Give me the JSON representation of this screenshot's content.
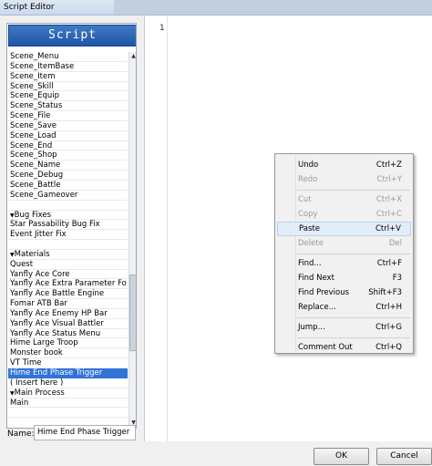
{
  "window": {
    "title": "Script Editor"
  },
  "script_list": {
    "header": "Script",
    "items": [
      {
        "label": "Scene_Menu"
      },
      {
        "label": "Scene_ItemBase"
      },
      {
        "label": "Scene_Item"
      },
      {
        "label": "Scene_Skill"
      },
      {
        "label": "Scene_Equip"
      },
      {
        "label": "Scene_Status"
      },
      {
        "label": "Scene_File"
      },
      {
        "label": "Scene_Save"
      },
      {
        "label": "Scene_Load"
      },
      {
        "label": "Scene_End"
      },
      {
        "label": "Scene_Shop"
      },
      {
        "label": "Scene_Name"
      },
      {
        "label": "Scene_Debug"
      },
      {
        "label": "Scene_Battle"
      },
      {
        "label": "Scene_Gameover"
      },
      {
        "label": ""
      },
      {
        "label": "Bug Fixes",
        "section": true
      },
      {
        "label": "Star Passability Bug Fix"
      },
      {
        "label": "Event Jitter Fix"
      },
      {
        "label": ""
      },
      {
        "label": "Materials",
        "section": true
      },
      {
        "label": "Quest"
      },
      {
        "label": "Yanfly Ace Core"
      },
      {
        "label": "Yanfly Ace Extra Parameter Fo"
      },
      {
        "label": "Yanfly Ace Battle Engine"
      },
      {
        "label": "Fomar ATB Bar"
      },
      {
        "label": "Yanfly Ace Enemy HP Bar"
      },
      {
        "label": "Yanfly Ace Visual Battler"
      },
      {
        "label": "Yanfly Ace Status Menu"
      },
      {
        "label": "Hime Large Troop"
      },
      {
        "label": "Monster book"
      },
      {
        "label": "VT Time"
      },
      {
        "label": "Hime End Phase Trigger",
        "selected": true
      },
      {
        "label": "( Insert here )"
      },
      {
        "label": "Main Process",
        "section": true
      },
      {
        "label": "Main"
      },
      {
        "label": ""
      }
    ],
    "scroll_position": 0.76
  },
  "name_field": {
    "label": "Name:",
    "value": "Hime End Phase Trigger"
  },
  "editor": {
    "line_number": "1",
    "content": ""
  },
  "buttons": {
    "ok": "OK",
    "cancel": "Cancel"
  },
  "context_menu": {
    "groups": [
      [
        {
          "label": "Undo",
          "shortcut": "Ctrl+Z",
          "enabled": true
        },
        {
          "label": "Redo",
          "shortcut": "Ctrl+Y",
          "enabled": false
        }
      ],
      [
        {
          "label": "Cut",
          "shortcut": "Ctrl+X",
          "enabled": false
        },
        {
          "label": "Copy",
          "shortcut": "Ctrl+C",
          "enabled": false
        },
        {
          "label": "Paste",
          "shortcut": "Ctrl+V",
          "enabled": true,
          "highlighted": true
        },
        {
          "label": "Delete",
          "shortcut": "Del",
          "enabled": false
        }
      ],
      [
        {
          "label": "Find...",
          "shortcut": "Ctrl+F",
          "enabled": true
        },
        {
          "label": "Find Next",
          "shortcut": "F3",
          "enabled": true
        },
        {
          "label": "Find Previous",
          "shortcut": "Shift+F3",
          "enabled": true
        },
        {
          "label": "Replace...",
          "shortcut": "Ctrl+H",
          "enabled": true
        }
      ],
      [
        {
          "label": "Jump...",
          "shortcut": "Ctrl+G",
          "enabled": true
        }
      ],
      [
        {
          "label": "Comment Out",
          "shortcut": "Ctrl+Q",
          "enabled": true
        }
      ]
    ]
  },
  "colors": {
    "header_blue": "#1f56a6",
    "selection_blue": "#3373d8",
    "menu_highlight": "#e3edf9"
  }
}
